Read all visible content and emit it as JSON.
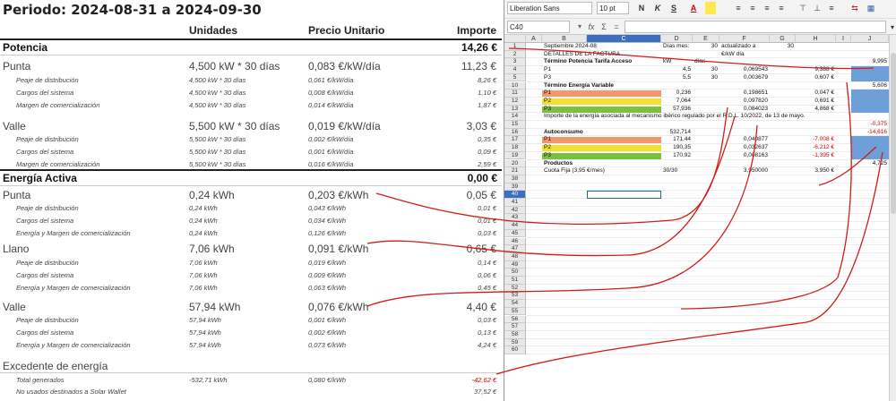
{
  "invoice": {
    "title": "Periodo: 2024-08-31 a 2024-09-30",
    "headers": {
      "units": "Unidades",
      "price": "Precio Unitario",
      "amount": "Importe"
    },
    "sections": {
      "potencia": {
        "label": "Potencia",
        "total": "14,26 €"
      },
      "energia": {
        "label": "Energía Activa",
        "total": "0,00 €"
      },
      "excedente": {
        "label": "Excedente de energía"
      }
    },
    "rows": [
      {
        "type": "main",
        "label": "Punta",
        "units": "4,500 kW * 30 días",
        "price": "0,083 €/kW/día",
        "amount": "11,23 €"
      },
      {
        "type": "sub",
        "label": "Peaje de distribución",
        "units": "4,500 kW * 30 días",
        "price": "0,061 €/kW/día",
        "amount": "8,26 €"
      },
      {
        "type": "sub",
        "label": "Cargos del sistema",
        "units": "4,500 kW * 30 días",
        "price": "0,008 €/kW/día",
        "amount": "1,10 €"
      },
      {
        "type": "sub",
        "label": "Margen de comercialización",
        "units": "4,500 kW * 30 días",
        "price": "0,014 €/kW/día",
        "amount": "1,87 €"
      },
      {
        "type": "main",
        "label": "Valle",
        "units": "5,500 kW * 30 días",
        "price": "0,019 €/kW/día",
        "amount": "3,03 €"
      },
      {
        "type": "sub",
        "label": "Peaje de distribución",
        "units": "5,500 kW * 30 días",
        "price": "0,002 €/kW/día",
        "amount": "0,35 €"
      },
      {
        "type": "sub",
        "label": "Cargos del sistema",
        "units": "5,500 kW * 30 días",
        "price": "0,001 €/kW/día",
        "amount": "0,09 €"
      },
      {
        "type": "sub",
        "label": "Margen de comercialización",
        "units": "5,500 kW * 30 días",
        "price": "0,016 €/kW/día",
        "amount": "2,59 €"
      },
      {
        "type": "main",
        "label": "Punta",
        "units": "0,24 kWh",
        "price": "0,203 €/kWh",
        "amount": "0,05 €"
      },
      {
        "type": "sub",
        "label": "Peaje de distribución",
        "units": "0,24 kWh",
        "price": "0,043 €/kWh",
        "amount": "0,01 €"
      },
      {
        "type": "sub",
        "label": "Cargos del sistema",
        "units": "0,24 kWh",
        "price": "0,034 €/kWh",
        "amount": "0,01 €"
      },
      {
        "type": "sub",
        "label": "Energía y Margen de comercialización",
        "units": "0,24 kWh",
        "price": "0,126 €/kWh",
        "amount": "0,03 €"
      },
      {
        "type": "main",
        "label": "Llano",
        "units": "7,06 kWh",
        "price": "0,091 €/kWh",
        "amount": "0,65 €"
      },
      {
        "type": "sub",
        "label": "Peaje de distribución",
        "units": "7,06 kWh",
        "price": "0,019 €/kWh",
        "amount": "0,14 €"
      },
      {
        "type": "sub",
        "label": "Cargos del sistema",
        "units": "7,06 kWh",
        "price": "0,009 €/kWh",
        "amount": "0,06 €"
      },
      {
        "type": "sub",
        "label": "Energía y Margen de comercialización",
        "units": "7,06 kWh",
        "price": "0,063 €/kWh",
        "amount": "0,45 €"
      },
      {
        "type": "main",
        "label": "Valle",
        "units": "57,94 kWh",
        "price": "0,076 €/kWh",
        "amount": "4,40 €"
      },
      {
        "type": "sub",
        "label": "Peaje de distribución",
        "units": "57,94 kWh",
        "price": "0,001 €/kWh",
        "amount": "0,03 €"
      },
      {
        "type": "sub",
        "label": "Cargos del sistema",
        "units": "57,94 kWh",
        "price": "0,002 €/kWh",
        "amount": "0,13 €"
      },
      {
        "type": "sub",
        "label": "Energía y Margen de comercialización",
        "units": "57,94 kWh",
        "price": "0,073 €/kWh",
        "amount": "4,24 €"
      },
      {
        "type": "sub",
        "label": "Total generados",
        "units": "-532,71 kWh",
        "price": "0,080 €/kWh",
        "amount": "-42,62 €"
      },
      {
        "type": "sub",
        "label": "No usados destinados a Solar Wallet",
        "units": "",
        "price": "",
        "amount": "37,52 €"
      }
    ]
  },
  "spreadsheet": {
    "font_name": "Liberation Sans",
    "font_size": "10 pt",
    "toolbar_buttons": [
      "N",
      "K",
      "S",
      "A",
      "≡",
      "≡",
      "≡",
      "≡",
      "⊤",
      "⊥",
      "≡"
    ],
    "cell_ref": "C40",
    "formula_icons": [
      "fx",
      "Σ",
      "="
    ],
    "columns": [
      "A",
      "B",
      "C",
      "D",
      "E",
      "F",
      "G",
      "H",
      "I",
      "J"
    ],
    "selected_column": "C",
    "selected_row": "40",
    "fill_colors": {
      "p1": "#f4976c",
      "p2": "#f0e130",
      "p3": "#7bc043",
      "blue": "#6f9fd8"
    },
    "rows_top": [
      "1",
      "2",
      "3",
      "4",
      "5",
      "10",
      "11",
      "12",
      "13",
      "14",
      "15",
      "16",
      "17",
      "18",
      "19",
      "20",
      "21"
    ],
    "rows_bottom": [
      "38",
      "39",
      "40",
      "41",
      "42",
      "43",
      "44",
      "45",
      "46",
      "47",
      "48",
      "49",
      "50",
      "51",
      "52",
      "53",
      "54",
      "55",
      "56",
      "57",
      "58",
      "59",
      "60"
    ],
    "cells": [
      {
        "r": 0,
        "col": "B",
        "v": "Septiembre 2024-08"
      },
      {
        "r": 0,
        "col": "D",
        "v": "Días mes:"
      },
      {
        "r": 0,
        "col": "E",
        "v": "30",
        "right": true
      },
      {
        "r": 0,
        "col": "F",
        "v": "actualizado a"
      },
      {
        "r": 0,
        "col": "G",
        "v": "30",
        "right": true
      },
      {
        "r": 1,
        "col": "B",
        "v": "DETALLES DE LA FACTURA"
      },
      {
        "r": 1,
        "col": "F",
        "v": "€/kW día"
      },
      {
        "r": 2,
        "col": "B",
        "v": "Término Potencia Tarifa Acceso",
        "bold": true
      },
      {
        "r": 2,
        "col": "D",
        "v": "kW"
      },
      {
        "r": 2,
        "col": "E",
        "v": "días"
      },
      {
        "r": 2,
        "col": "J",
        "v": "9,995",
        "right": true
      },
      {
        "r": 3,
        "col": "B",
        "v": "P1"
      },
      {
        "r": 3,
        "col": "D",
        "v": "4,5",
        "right": true
      },
      {
        "r": 3,
        "col": "E",
        "v": "30",
        "right": true
      },
      {
        "r": 3,
        "col": "F",
        "v": "0,069543",
        "right": true
      },
      {
        "r": 3,
        "col": "H",
        "v": "9,388 €",
        "right": true
      },
      {
        "r": 4,
        "col": "B",
        "v": "P3"
      },
      {
        "r": 4,
        "col": "D",
        "v": "5,5",
        "right": true
      },
      {
        "r": 4,
        "col": "E",
        "v": "30",
        "right": true
      },
      {
        "r": 4,
        "col": "F",
        "v": "0,003679",
        "right": true
      },
      {
        "r": 4,
        "col": "H",
        "v": "0,607 €",
        "right": true
      },
      {
        "r": 5,
        "col": "B",
        "v": "Término Energía Variable",
        "bold": true
      },
      {
        "r": 5,
        "col": "J",
        "v": "5,606",
        "right": true
      },
      {
        "r": 6,
        "col": "B",
        "v": "P1"
      },
      {
        "r": 6,
        "col": "D",
        "v": "0,236",
        "right": true
      },
      {
        "r": 6,
        "col": "F",
        "v": "0,198651",
        "right": true
      },
      {
        "r": 6,
        "col": "H",
        "v": "0,047 €",
        "right": true
      },
      {
        "r": 7,
        "col": "B",
        "v": "P2"
      },
      {
        "r": 7,
        "col": "D",
        "v": "7,064",
        "right": true
      },
      {
        "r": 7,
        "col": "F",
        "v": "0,097820",
        "right": true
      },
      {
        "r": 7,
        "col": "H",
        "v": "0,691 €",
        "right": true
      },
      {
        "r": 8,
        "col": "B",
        "v": "P3"
      },
      {
        "r": 8,
        "col": "D",
        "v": "57,936",
        "right": true
      },
      {
        "r": 8,
        "col": "F",
        "v": "0,084023",
        "right": true
      },
      {
        "r": 8,
        "col": "H",
        "v": "4,868 €",
        "right": true
      },
      {
        "r": 9,
        "col": "B",
        "v": "Importe de la energía asociada al mecanismo ibérico regulado por el R.D.L. 10/2022, de 13 de mayo."
      },
      {
        "r": 10,
        "col": "J",
        "v": "-0,375",
        "right": true,
        "red": true
      },
      {
        "r": 11,
        "col": "B",
        "v": "Autoconsumo",
        "bold": true
      },
      {
        "r": 11,
        "col": "D",
        "v": "532,714",
        "right": true
      },
      {
        "r": 11,
        "col": "J",
        "v": "-14,616",
        "right": true,
        "red": true
      },
      {
        "r": 12,
        "col": "B",
        "v": "P1"
      },
      {
        "r": 12,
        "col": "D",
        "v": "171,44",
        "right": true
      },
      {
        "r": 12,
        "col": "F",
        "v": "0,040877",
        "right": true
      },
      {
        "r": 12,
        "col": "H",
        "v": "-7,008 €",
        "right": true,
        "red": true
      },
      {
        "r": 13,
        "col": "B",
        "v": "P2"
      },
      {
        "r": 13,
        "col": "D",
        "v": "190,35",
        "right": true
      },
      {
        "r": 13,
        "col": "F",
        "v": "0,032637",
        "right": true
      },
      {
        "r": 13,
        "col": "H",
        "v": "-6,212 €",
        "right": true,
        "red": true
      },
      {
        "r": 14,
        "col": "B",
        "v": "P3"
      },
      {
        "r": 14,
        "col": "D",
        "v": "170,92",
        "right": true
      },
      {
        "r": 14,
        "col": "F",
        "v": "0,008163",
        "right": true
      },
      {
        "r": 14,
        "col": "H",
        "v": "-1,395 €",
        "right": true,
        "red": true
      },
      {
        "r": 15,
        "col": "B",
        "v": "Productos",
        "bold": true
      },
      {
        "r": 15,
        "col": "J",
        "v": "4,725",
        "right": true
      },
      {
        "r": 16,
        "col": "B",
        "v": "Cuota Fija (3,95 €/mes)"
      },
      {
        "r": 16,
        "col": "D",
        "v": "30/30"
      },
      {
        "r": 16,
        "col": "F",
        "v": "3,950000",
        "right": true
      },
      {
        "r": 16,
        "col": "H",
        "v": "3,950 €",
        "right": true
      }
    ]
  }
}
